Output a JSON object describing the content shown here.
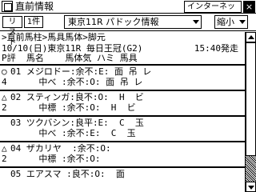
{
  "titlebar": {
    "title": "直前情報",
    "net_button": "インターネット接続",
    "close": "×"
  },
  "toolbar": {
    "list_button": "リスト",
    "single_button": "1件",
    "race_select": "東京11R パドック情報",
    "zoom_select": "縮小"
  },
  "breadcrumb": ">直前馬柱>馬具馬体>脚元",
  "race": {
    "date_course": "10/10(日)東京11R 毎日王冠(G2)",
    "start_time": "15:40発走"
  },
  "column_header": "P評  馬名    馬体気 ハミ 馬具",
  "horses": [
    {
      "mark": "○",
      "row1": "01 メジロドー:余不:E: 面 吊 レ",
      "row2": "4      中べ :余不:O: 面 吊 レ"
    },
    {
      "mark": "△",
      "row1": "02 スティンガ:良不:O:  H  ビ",
      "row2": "2      中標 :余不:O:  H  ビ"
    },
    {
      "mark": "",
      "row1": "03 ツクバシン:良平:E:  C  玉",
      "row2": "       中べ :余不:E:  C  玉"
    },
    {
      "mark": "△",
      "row1": "04 ザカリヤ  :余不:O:",
      "row2": "2      中標 :余不:O:"
    },
    {
      "mark": "",
      "row1": "05 エアスマ :良不:O:  面",
      "row2": ""
    }
  ]
}
